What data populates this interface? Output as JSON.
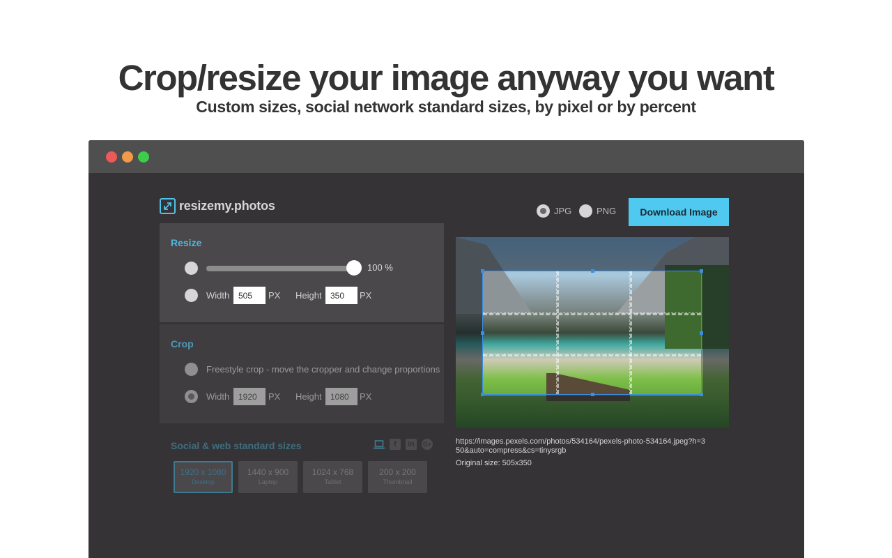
{
  "hero": {
    "title": "Crop/resize your image anyway you want",
    "subtitle": "Custom sizes, social network standard sizes, by pixel or by percent"
  },
  "window": {
    "controls": [
      "close",
      "minimize",
      "maximize"
    ]
  },
  "app": {
    "logo_text": "resizemy.photos",
    "logo_icon": "expand-arrows-icon"
  },
  "resize": {
    "title": "Resize",
    "percent_value": 100,
    "percent_label": "100 %",
    "width_label": "Width",
    "width_value": "505",
    "height_label": "Height",
    "height_value": "350",
    "unit": "PX",
    "mode": "percent"
  },
  "crop": {
    "title": "Crop",
    "freestyle_label": "Freestyle crop - move the cropper and change proportions",
    "width_label": "Width",
    "width_value": "1920",
    "height_label": "Height",
    "height_value": "1080",
    "unit": "PX",
    "mode": "fixed"
  },
  "social": {
    "title": "Social & web standard sizes",
    "icons": [
      "laptop-icon",
      "facebook-icon",
      "linkedin-icon",
      "google-plus-icon"
    ],
    "icon_glyphs": [
      "",
      "f",
      "in",
      "G+"
    ],
    "sizes": [
      {
        "dim": "1920 x 1080",
        "name": "Desktop",
        "active": true
      },
      {
        "dim": "1440 x 900",
        "name": "Laptop",
        "active": false
      },
      {
        "dim": "1024 x 768",
        "name": "Tablet",
        "active": false
      },
      {
        "dim": "200 x 200",
        "name": "Thumbnail",
        "active": false
      }
    ]
  },
  "output": {
    "formats": [
      "JPG",
      "PNG"
    ],
    "selected_format": "JPG",
    "download_label": "Download Image"
  },
  "image": {
    "url": "https://images.pexels.com/photos/534164/pexels-photo-534164.jpeg?h=350&auto=compress&cs=tinysrgb",
    "original_size": "Original size: 505x350"
  },
  "colors": {
    "accent": "#4fc9f0",
    "window_bg": "#353336",
    "titlebar": "#4f4f4f"
  }
}
